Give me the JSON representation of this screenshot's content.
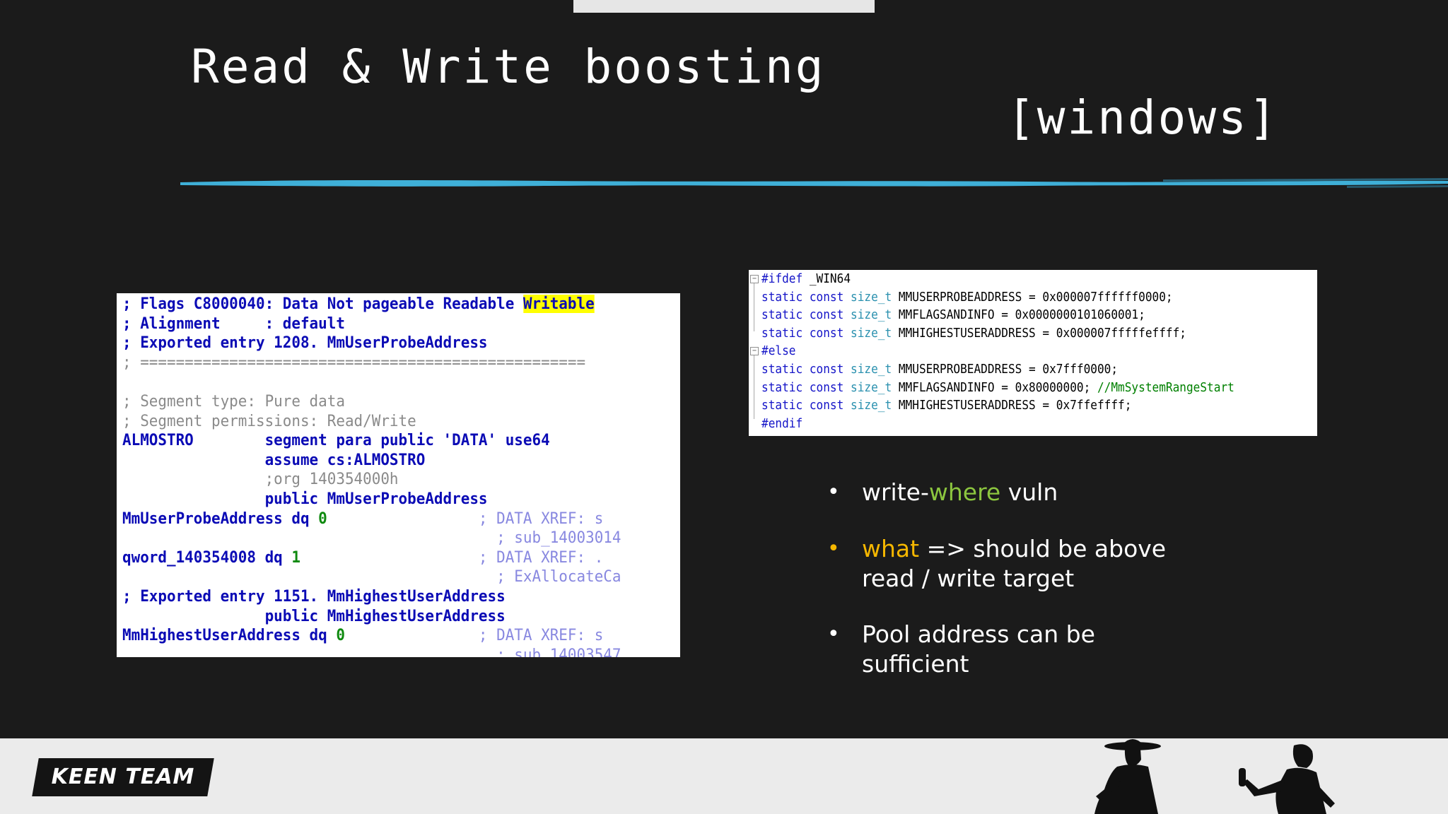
{
  "slide": {
    "title": "Read & Write boosting",
    "subtitle": "[windows]"
  },
  "ida_listing": {
    "lines": [
      {
        "parts": [
          {
            "t": "; Flags C8000040: Data Not pageable Readable ",
            "c": "navy"
          },
          {
            "t": "Writable",
            "c": "navy",
            "hl": true
          }
        ]
      },
      {
        "parts": [
          {
            "t": "; Alignment     : default",
            "c": "navy"
          }
        ]
      },
      {
        "parts": [
          {
            "t": "; Exported entry 1208. MmUserProbeAddress",
            "c": "navy"
          }
        ]
      },
      {
        "parts": [
          {
            "t": "; ==================================================",
            "c": "gray"
          }
        ]
      },
      {
        "parts": [
          {
            "t": "",
            "c": "gray"
          }
        ]
      },
      {
        "parts": [
          {
            "t": "; Segment type: Pure data",
            "c": "gray"
          }
        ]
      },
      {
        "parts": [
          {
            "t": "; Segment permissions: Read/Write",
            "c": "gray"
          }
        ]
      },
      {
        "parts": [
          {
            "t": "ALMOSTRO        segment para public 'DATA' use64",
            "c": "navy"
          }
        ]
      },
      {
        "parts": [
          {
            "t": "                assume cs:ALMOSTRO",
            "c": "navy"
          }
        ]
      },
      {
        "parts": [
          {
            "t": "                ;org 140354000h",
            "c": "gray"
          }
        ]
      },
      {
        "parts": [
          {
            "t": "                public MmUserProbeAddress",
            "c": "navy"
          }
        ]
      },
      {
        "parts": [
          {
            "t": "MmUserProbeAddress dq ",
            "c": "navy"
          },
          {
            "t": "0",
            "c": "green"
          },
          {
            "t": "                 ; DATA XREF: s",
            "c": "lblue"
          }
        ]
      },
      {
        "parts": [
          {
            "t": "                                          ; sub_14003014",
            "c": "lblue"
          }
        ]
      },
      {
        "parts": [
          {
            "t": "qword_140354008 dq ",
            "c": "navy"
          },
          {
            "t": "1",
            "c": "green"
          },
          {
            "t": "                    ; DATA XREF: .",
            "c": "lblue"
          }
        ]
      },
      {
        "parts": [
          {
            "t": "                                          ; ExAllocateCa",
            "c": "lblue"
          }
        ]
      },
      {
        "parts": [
          {
            "t": "; Exported entry 1151. MmHighestUserAddress",
            "c": "navy"
          }
        ]
      },
      {
        "parts": [
          {
            "t": "                public MmHighestUserAddress",
            "c": "navy"
          }
        ]
      },
      {
        "parts": [
          {
            "t": "MmHighestUserAddress dq ",
            "c": "navy"
          },
          {
            "t": "0",
            "c": "green"
          },
          {
            "t": "               ; DATA XREF: s",
            "c": "lblue"
          }
        ]
      },
      {
        "parts": [
          {
            "t": "                                          ; sub_14003547",
            "c": "lblue"
          }
        ]
      }
    ]
  },
  "cpp_snippet": {
    "lines": [
      {
        "parts": [
          {
            "t": "#ifdef",
            "c": "kw"
          },
          {
            "t": " _WIN64",
            "c": "pl"
          }
        ]
      },
      {
        "parts": [
          {
            "t": "static const ",
            "c": "kw"
          },
          {
            "t": "size_t",
            "c": "ty"
          },
          {
            "t": " MMUSERPROBEADDRESS = 0x000007ffffff0000;",
            "c": "pl"
          }
        ]
      },
      {
        "parts": [
          {
            "t": "static const ",
            "c": "kw"
          },
          {
            "t": "size_t",
            "c": "ty"
          },
          {
            "t": " MMFLAGSANDINFO = 0x0000000101060001;",
            "c": "pl"
          }
        ]
      },
      {
        "parts": [
          {
            "t": "static const ",
            "c": "kw"
          },
          {
            "t": "size_t",
            "c": "ty"
          },
          {
            "t": " MMHIGHESTUSERADDRESS = 0x000007fffffeffff;",
            "c": "pl"
          }
        ]
      },
      {
        "parts": [
          {
            "t": "#else",
            "c": "kw"
          }
        ]
      },
      {
        "parts": [
          {
            "t": "static const ",
            "c": "kw"
          },
          {
            "t": "size_t",
            "c": "ty"
          },
          {
            "t": " MMUSERPROBEADDRESS = 0x7fff0000;",
            "c": "pl"
          }
        ]
      },
      {
        "parts": [
          {
            "t": "static const ",
            "c": "kw"
          },
          {
            "t": "size_t",
            "c": "ty"
          },
          {
            "t": " MMFLAGSANDINFO = 0x80000000; ",
            "c": "pl"
          },
          {
            "t": "//MmSystemRangeStart",
            "c": "cm"
          }
        ]
      },
      {
        "parts": [
          {
            "t": "static const ",
            "c": "kw"
          },
          {
            "t": "size_t",
            "c": "ty"
          },
          {
            "t": " MMHIGHESTUSERADDRESS = 0x7ffeffff;",
            "c": "pl"
          }
        ]
      },
      {
        "parts": [
          {
            "t": "#endif",
            "c": "kw"
          }
        ]
      }
    ],
    "fold_symbol": "−"
  },
  "bullets": [
    {
      "dot_color": "#ffffff",
      "parts": [
        {
          "t": "write-",
          "c": "white"
        },
        {
          "t": "where",
          "c": "green"
        },
        {
          "t": " vuln",
          "c": "white"
        }
      ]
    },
    {
      "dot_color": "#f5b700",
      "parts": [
        {
          "t": "what",
          "c": "orange"
        },
        {
          "t": " => should be above read / write target",
          "c": "white"
        }
      ]
    },
    {
      "dot_color": "#ffffff",
      "parts": [
        {
          "t": "Pool address can be sufficient",
          "c": "white"
        }
      ]
    }
  ],
  "bullet_symbol": "•",
  "footer": {
    "logo_text": "KEEN TEAM"
  },
  "colors": {
    "background": "#1b1b1b",
    "accent_stroke": "#3fb0d8",
    "green_highlight": "#8cc63f",
    "orange_highlight": "#f5b700",
    "ida_navy": "#0b0bb5",
    "ida_highlight": "#ffff00"
  }
}
